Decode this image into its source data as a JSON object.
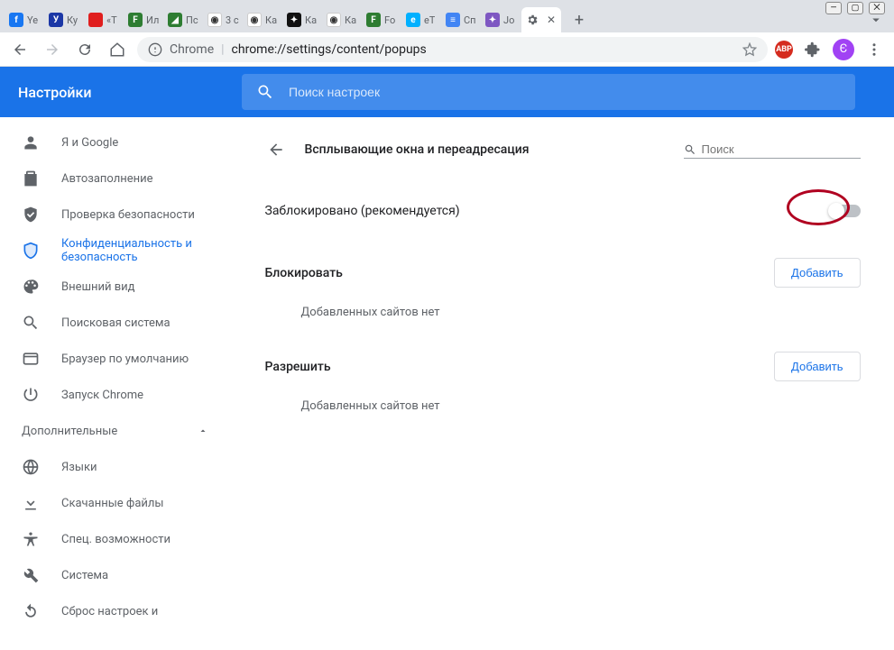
{
  "window": {
    "tabs": [
      {
        "title": "Ye",
        "color": "#1877f2",
        "glyph": "f"
      },
      {
        "title": "Ку",
        "color": "#1b37a6",
        "glyph": "У"
      },
      {
        "title": "«Т",
        "color": "#e01e1e",
        "glyph": ""
      },
      {
        "title": "Ил",
        "color": "#2e7d32",
        "glyph": "F"
      },
      {
        "title": "Пс",
        "color": "#2e7d32",
        "glyph": "◢"
      },
      {
        "title": "3 с",
        "color": "#fff",
        "glyph": "◉"
      },
      {
        "title": "Ка",
        "color": "#fff",
        "glyph": "◉"
      },
      {
        "title": "Ка",
        "color": "#111",
        "glyph": "✦"
      },
      {
        "title": "Ка",
        "color": "#fff",
        "glyph": "◉"
      },
      {
        "title": "Fo",
        "color": "#2e7d32",
        "glyph": "F"
      },
      {
        "title": "eT",
        "color": "#00b0ff",
        "glyph": "e"
      },
      {
        "title": "Сп",
        "color": "#4285f4",
        "glyph": "≡"
      },
      {
        "title": "Jo",
        "color": "#7e57c2",
        "glyph": "✦"
      }
    ],
    "active_tab": {
      "title": ""
    }
  },
  "toolbar": {
    "scheme_label": "Chrome",
    "url_path": "chrome://settings/content/popups"
  },
  "header": {
    "title": "Настройки",
    "search_placeholder": "Поиск настроек"
  },
  "sidebar": {
    "items": [
      {
        "label": "Я и Google",
        "icon": "person"
      },
      {
        "label": "Автозаполнение",
        "icon": "clipboard"
      },
      {
        "label": "Проверка безопасности",
        "icon": "shield-check"
      },
      {
        "label": "Конфиденциальность и безопасность",
        "icon": "shield"
      },
      {
        "label": "Внешний вид",
        "icon": "palette"
      },
      {
        "label": "Поисковая система",
        "icon": "search"
      },
      {
        "label": "Браузер по умолчанию",
        "icon": "window"
      },
      {
        "label": "Запуск Chrome",
        "icon": "power"
      }
    ],
    "advanced_label": "Дополнительные",
    "advanced_items": [
      {
        "label": "Языки",
        "icon": "globe"
      },
      {
        "label": "Скачанные файлы",
        "icon": "download"
      },
      {
        "label": "Спец. возможности",
        "icon": "accessibility"
      },
      {
        "label": "Система",
        "icon": "wrench"
      },
      {
        "label": "Сброс настроек и",
        "icon": "reset"
      }
    ]
  },
  "page": {
    "title": "Всплывающие окна и переадресация",
    "search_placeholder": "Поиск",
    "toggle_label": "Заблокировано (рекомендуется)",
    "block": {
      "title": "Блокировать",
      "empty": "Добавленных сайтов нет",
      "add": "Добавить"
    },
    "allow": {
      "title": "Разрешить",
      "empty": "Добавленных сайтов нет",
      "add": "Добавить"
    }
  }
}
